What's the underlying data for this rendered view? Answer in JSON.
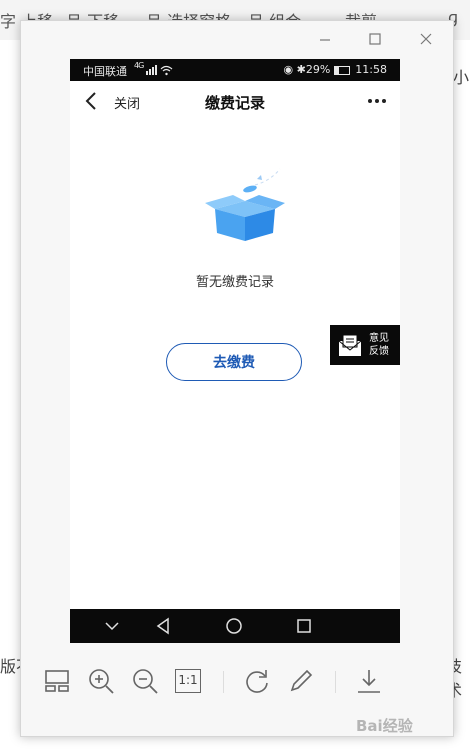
{
  "background_app": {
    "toolbar_items": [
      "字 上移",
      "吕 下移",
      "吕 选择窗格",
      "吕 组合",
      "裁剪",
      "ɡ"
    ],
    "right_fragments": [
      "小"
    ],
    "left_doc_fragment": "版不",
    "right_doc_fragment": "技术"
  },
  "viewer": {
    "window_controls": [
      "minimize",
      "maximize",
      "close"
    ],
    "tools": [
      "layout-icon",
      "zoom-in-icon",
      "zoom-out-icon",
      "actual-size-icon",
      "rotate-icon",
      "edit-icon",
      "download-icon"
    ],
    "actual_size_label": "1:1",
    "watermark_text": "Bai经验"
  },
  "phone": {
    "status_bar": {
      "carrier": "中国联通",
      "network": "4G",
      "battery_pct": "29%",
      "time": "11:58"
    },
    "nav": {
      "close_label": "关闭",
      "title": "缴费记录"
    },
    "content": {
      "empty_text": "暂无缴费记录",
      "pay_button_label": "去缴费"
    },
    "feedback": {
      "line1": "意见",
      "line2": "反馈"
    }
  },
  "colors": {
    "accent": "#1f5bb5",
    "illustration": "#4aa3f0"
  }
}
